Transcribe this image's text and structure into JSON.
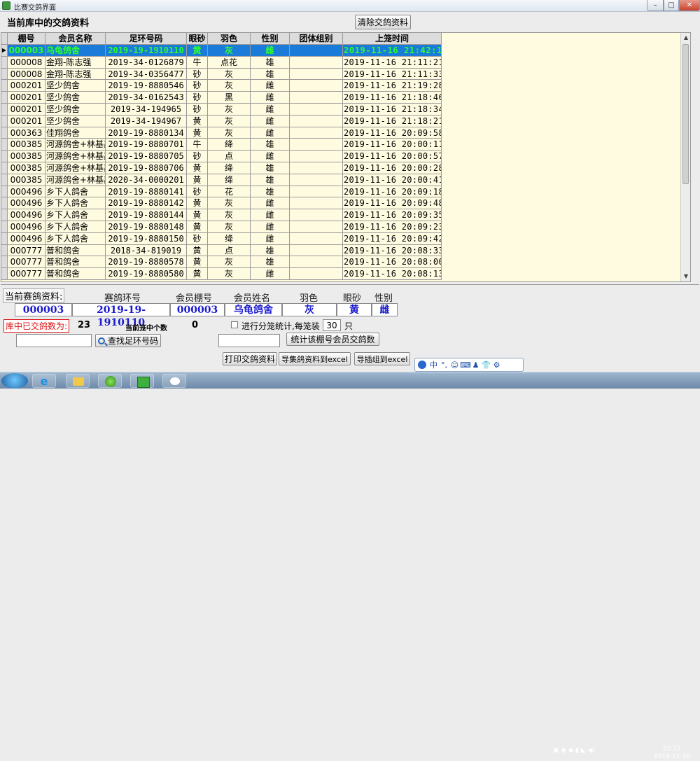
{
  "window": {
    "title": "比赛交鸽界面",
    "close": "✕",
    "maximize": "□",
    "minimize": "–"
  },
  "db_label": "当前库中的交鸽资料",
  "clear_button": "清除交鸽资料",
  "table": {
    "columns": [
      "棚号",
      "会员名称",
      "足环号码",
      "眼砂",
      "羽色",
      "性别",
      "团体组别",
      "上笼时间"
    ],
    "rows": [
      [
        "000003",
        "乌龟鸽舍",
        "2019-19-1910110",
        "黄",
        "灰",
        "雌",
        "",
        "2019-11-16 21:42:1"
      ],
      [
        "000008",
        "金翔-陈志强",
        "2019-34-0126879",
        "牛",
        "点花",
        "雄",
        "",
        "2019-11-16 21:11:21"
      ],
      [
        "000008",
        "金翔-陈志强",
        "2019-34-0356477",
        "砂",
        "灰",
        "雄",
        "",
        "2019-11-16 21:11:33"
      ],
      [
        "000201",
        "坚少鸽舍",
        "2019-19-8880546",
        "砂",
        "灰",
        "雌",
        "",
        "2019-11-16 21:19:28"
      ],
      [
        "000201",
        "坚少鸽舍",
        "2019-34-0162543",
        "砂",
        "黑",
        "雌",
        "",
        "2019-11-16 21:18:46"
      ],
      [
        "000201",
        "坚少鸽舍",
        "2019-34-194965",
        "砂",
        "灰",
        "雌",
        "",
        "2019-11-16 21:18:34"
      ],
      [
        "000201",
        "坚少鸽舍",
        "2019-34-194967",
        "黄",
        "灰",
        "雌",
        "",
        "2019-11-16 21:18:21"
      ],
      [
        "000363",
        "佳翔鸽舍",
        "2019-19-8880134",
        "黄",
        "灰",
        "雌",
        "",
        "2019-11-16 20:09:58"
      ],
      [
        "000385",
        "河源鸽舍+林基鑫",
        "2019-19-8880701",
        "牛",
        "绛",
        "雄",
        "",
        "2019-11-16 20:00:11"
      ],
      [
        "000385",
        "河源鸽舍+林基鑫",
        "2019-19-8880705",
        "砂",
        "点",
        "雌",
        "",
        "2019-11-16 20:00:57"
      ],
      [
        "000385",
        "河源鸽舍+林基鑫",
        "2019-19-8880706",
        "黄",
        "绛",
        "雄",
        "",
        "2019-11-16 20:00:28"
      ],
      [
        "000385",
        "河源鸽舍+林基鑫",
        "2020-34-0000201",
        "黄",
        "绛",
        "雄",
        "",
        "2019-11-16 20:00:41"
      ],
      [
        "000496",
        "乡下人鸽舍",
        "2019-19-8880141",
        "砂",
        "花",
        "雄",
        "",
        "2019-11-16 20:09:18"
      ],
      [
        "000496",
        "乡下人鸽舍",
        "2019-19-8880142",
        "黄",
        "灰",
        "雌",
        "",
        "2019-11-16 20:09:48"
      ],
      [
        "000496",
        "乡下人鸽舍",
        "2019-19-8880144",
        "黄",
        "灰",
        "雌",
        "",
        "2019-11-16 20:09:35"
      ],
      [
        "000496",
        "乡下人鸽舍",
        "2019-19-8880148",
        "黄",
        "灰",
        "雌",
        "",
        "2019-11-16 20:09:23"
      ],
      [
        "000496",
        "乡下人鸽舍",
        "2019-19-8880150",
        "砂",
        "绛",
        "雌",
        "",
        "2019-11-16 20:09:42"
      ],
      [
        "000777",
        "普和鸽舍",
        "2018-34-819019",
        "黄",
        "点",
        "雄",
        "",
        "2019-11-16 20:08:33"
      ],
      [
        "000777",
        "普和鸽舍",
        "2019-19-8880578",
        "黄",
        "灰",
        "雄",
        "",
        "2019-11-16 20:08:00"
      ],
      [
        "000777",
        "普和鸽舍",
        "2019-19-8880580",
        "黄",
        "灰",
        "雌",
        "",
        "2019-11-16 20:08:13"
      ]
    ]
  },
  "current": {
    "label": "当前赛鸽资料:",
    "headers": [
      "赛鸽环号",
      "会员棚号",
      "会员姓名",
      "羽色",
      "眼砂",
      "性别"
    ],
    "values": [
      "000003",
      "2019-19-1910110",
      "000003",
      "乌龟鸽舍",
      "灰",
      "黄",
      "雌"
    ]
  },
  "totals": {
    "label": "库中已交鸽数为:",
    "value": "23",
    "cage_label": "当前笼中个数",
    "cage_value": "0",
    "stat_label": "进行分笼统计,每笼装",
    "stat_value": "30",
    "stat_unit": "只"
  },
  "buttons": {
    "find_ring": "查找足环号码",
    "stat_member": "统计该棚号会员交鸽数",
    "print": "打印交鸽资料",
    "export_excel": "导集鸽资料到excel",
    "export_group": "导插组到excel"
  },
  "ime": {
    "items": [
      "中",
      "°,",
      "☺",
      "⌨",
      "♟",
      "👕",
      "⚙"
    ]
  },
  "clock": {
    "time": "22:17",
    "date": "2019-11-16"
  },
  "colors": {
    "selected_row_bg": "#1a7cd8",
    "selected_row_text": "#2bff2b",
    "grid_bg": "#fffbe0",
    "value_text": "#1a1ad0",
    "total_label": "#d11111"
  }
}
